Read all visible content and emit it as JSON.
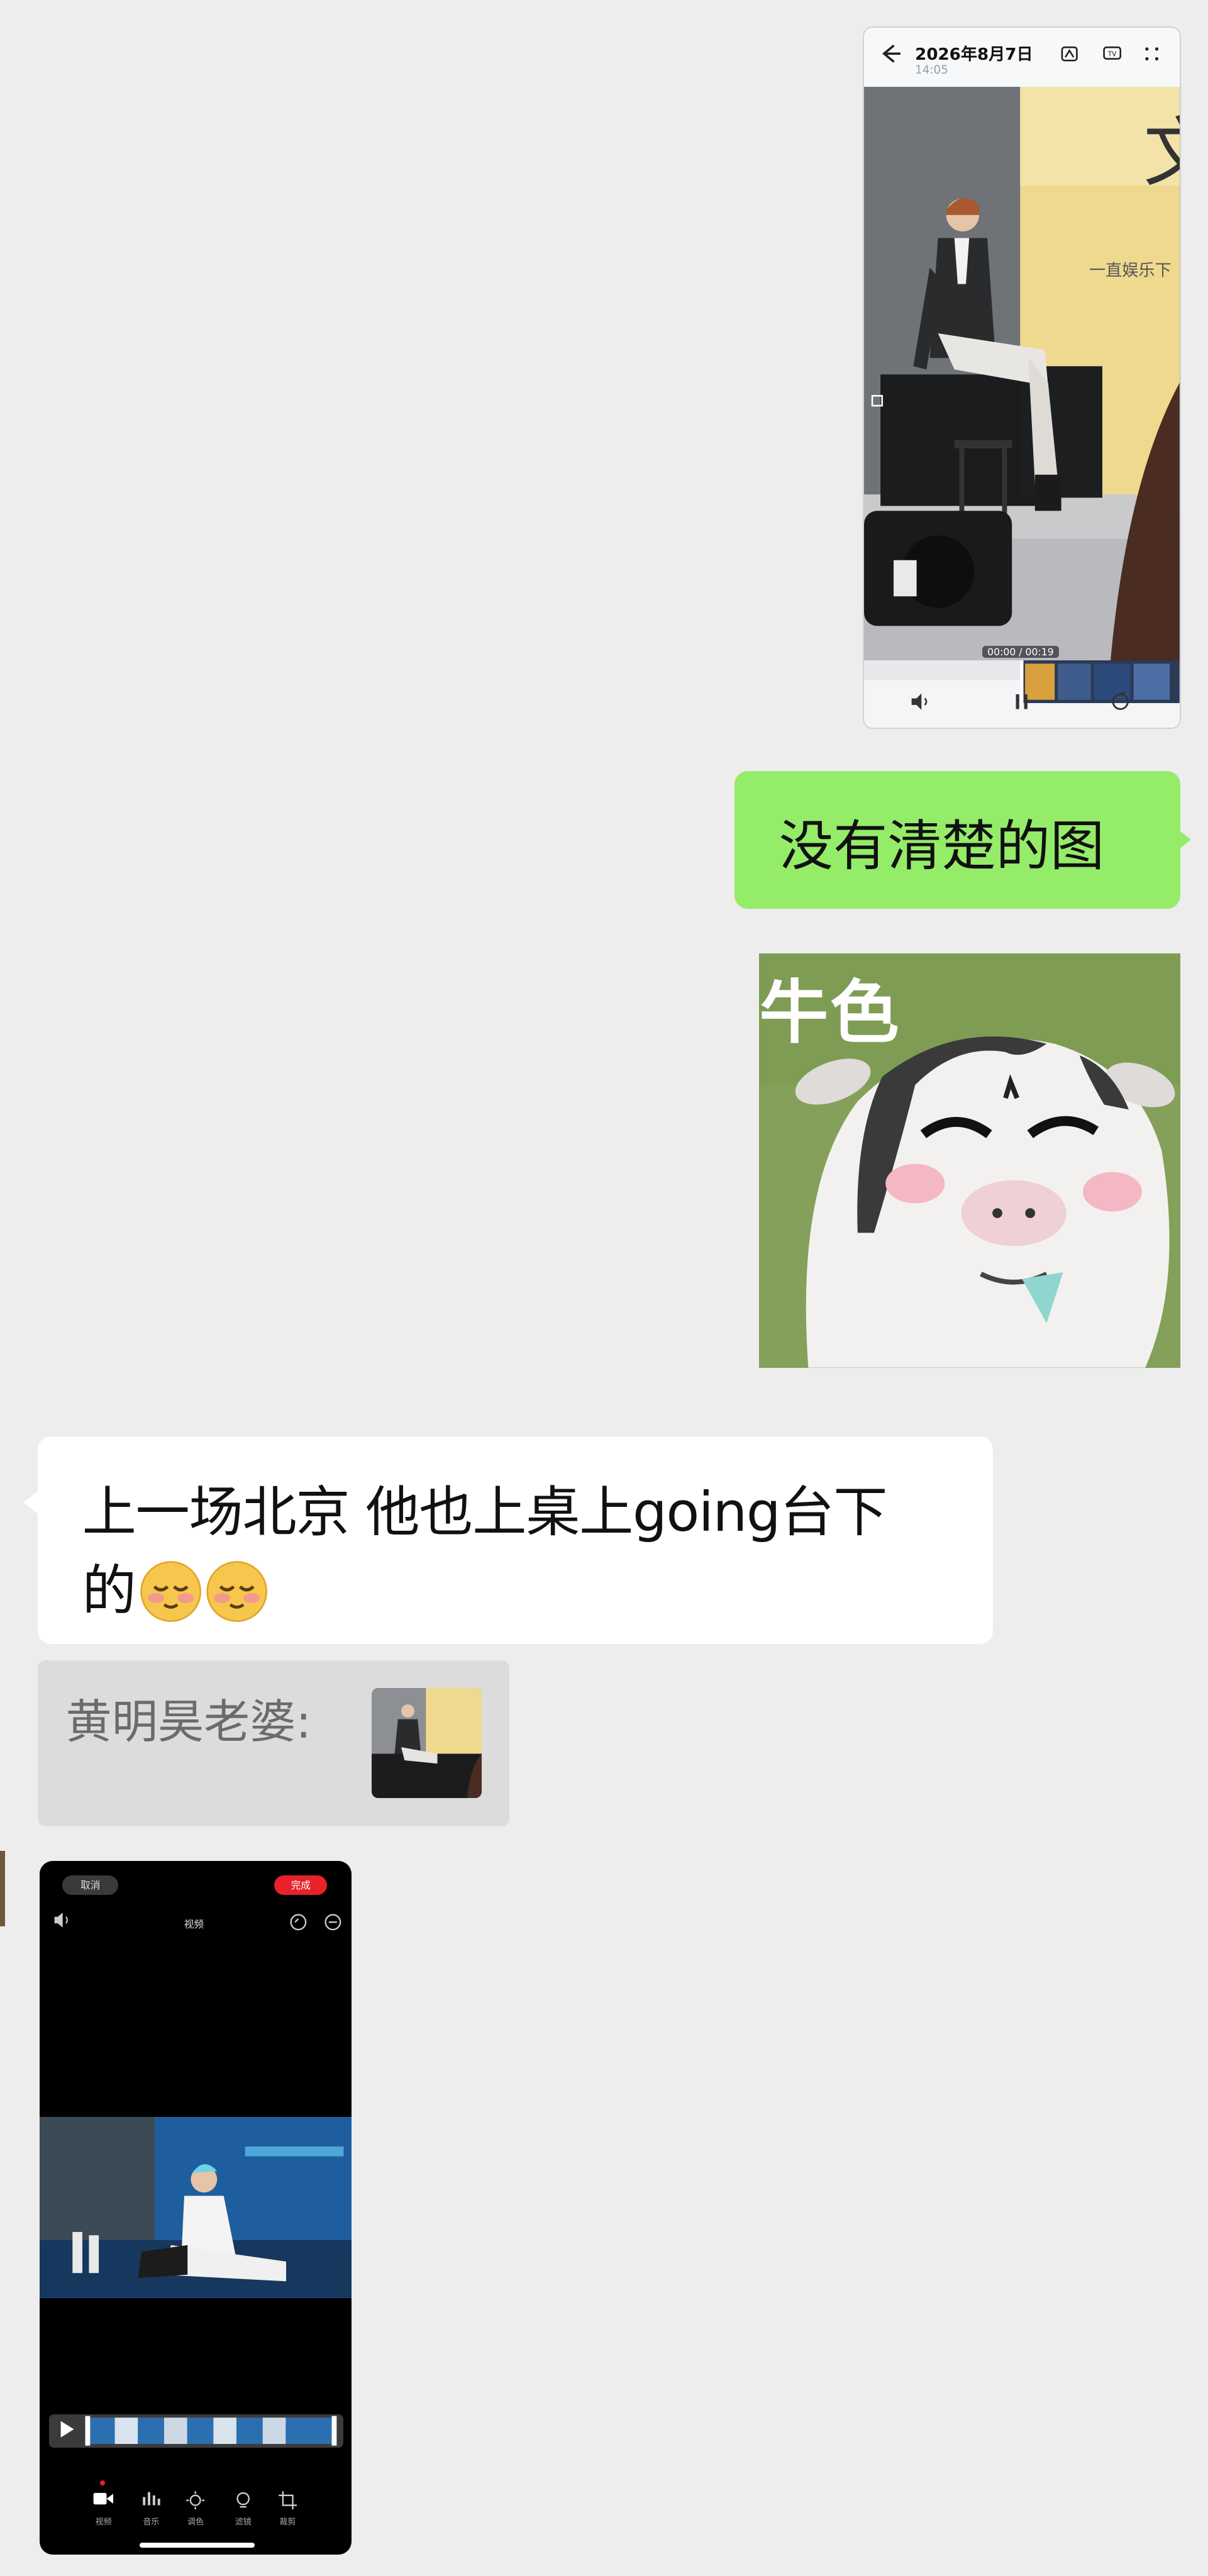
{
  "chat": {
    "video_screenshot": {
      "header": {
        "back_icon": "arrow-left-icon",
        "date": "2026年8月7日",
        "time": "14:05",
        "icons": [
          "edit-icon",
          "tv-cast-icon",
          "more-icon"
        ]
      },
      "timecode": "00:00 / 00:19",
      "controls": [
        "volume-icon",
        "pause-icon",
        "rotate-icon"
      ],
      "backdrop_text": "一直娱乐下"
    },
    "outgoing_message": {
      "text": "没有清楚的图"
    },
    "sticker": {
      "caption": "牛色"
    },
    "incoming_message": {
      "line1": "上一场北京 他也上桌上going台下",
      "line2": "的",
      "emoji": [
        "blushing-face-emoji",
        "blushing-face-emoji"
      ]
    },
    "quote": {
      "label": "黄明昊老婆:"
    },
    "phone_editor": {
      "cancel_label": "取消",
      "done_label": "完成",
      "title": "视频",
      "tools": [
        {
          "icon": "video-icon",
          "label": "视频"
        },
        {
          "icon": "audio-icon",
          "label": "音乐"
        },
        {
          "icon": "adjust-icon",
          "label": "调色"
        },
        {
          "icon": "filter-icon",
          "label": "滤镜"
        },
        {
          "icon": "crop-icon",
          "label": "裁剪"
        }
      ]
    }
  },
  "colors": {
    "background": "#ededed",
    "outgoing_bubble": "#95ec69",
    "incoming_bubble": "#ffffff",
    "quote_bg": "#dcdcdc",
    "editor_done": "#e8212b"
  }
}
